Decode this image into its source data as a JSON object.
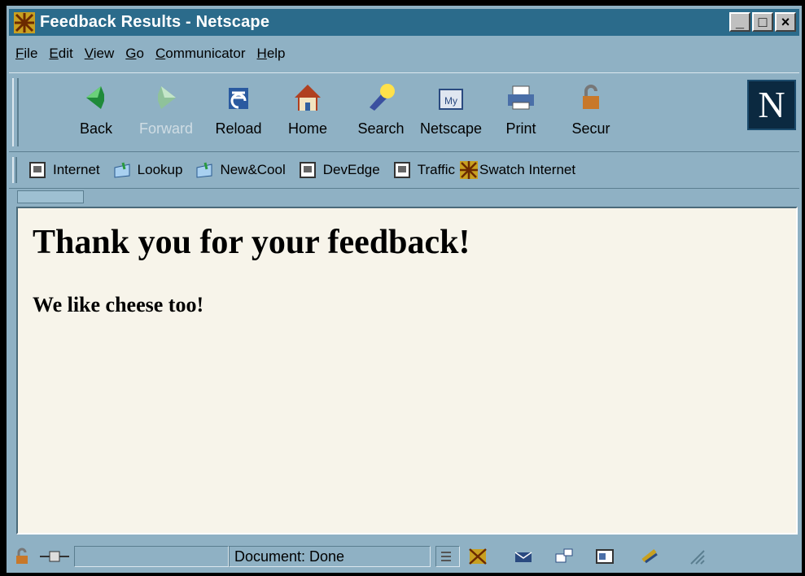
{
  "window": {
    "title": "Feedback Results - Netscape",
    "controls": {
      "minimize": "_",
      "maximize": "□",
      "close": "×"
    }
  },
  "menu": [
    {
      "key": "F",
      "rest": "ile"
    },
    {
      "key": "E",
      "rest": "dit"
    },
    {
      "key": "V",
      "rest": "iew"
    },
    {
      "key": "G",
      "rest": "o"
    },
    {
      "key": "C",
      "rest": "ommunicator"
    },
    {
      "key": "H",
      "rest": "elp"
    }
  ],
  "toolbar": {
    "back": "Back",
    "forward": "Forward",
    "reload": "Reload",
    "home": "Home",
    "search": "Search",
    "netscape": "Netscape",
    "print": "Print",
    "security": "Secur",
    "logo": "N"
  },
  "personal_toolbar": {
    "internet": "Internet",
    "lookup": "Lookup",
    "newcool": "New&Cool",
    "devedge": "DevEdge",
    "traffic": "Traffic",
    "swatch": "Swatch Internet"
  },
  "page": {
    "heading": "Thank you for your feedback!",
    "subheading": "We like cheese too!"
  },
  "status": {
    "text": "Document: Done"
  },
  "colors": {
    "chrome": "#8fb1c4",
    "titlebar": "#2b6b8b",
    "content_bg": "#f7f4ea"
  }
}
